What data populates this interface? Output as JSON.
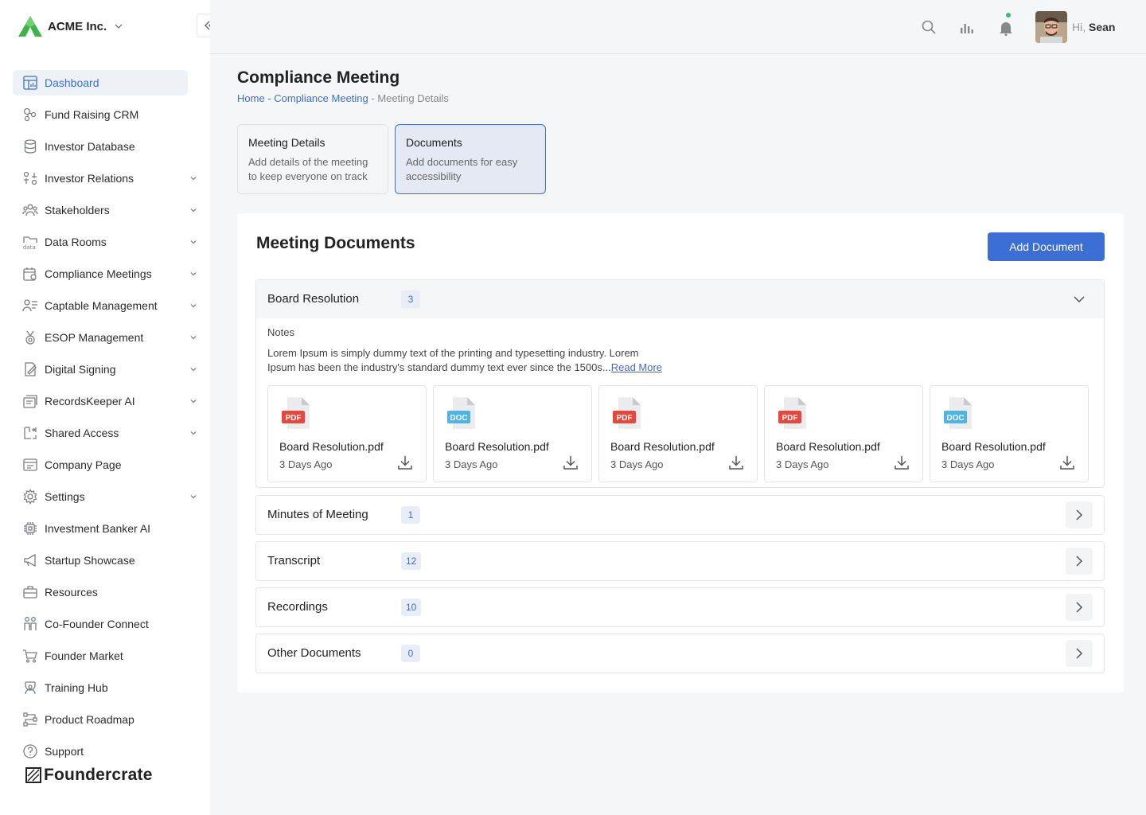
{
  "brand": {
    "name": "ACME Inc."
  },
  "sidebar": {
    "items": [
      {
        "label": "Dashboard",
        "icon": "dashboard-icon",
        "active": true,
        "chevron": false
      },
      {
        "label": "Fund Raising CRM",
        "icon": "crm-icon",
        "chevron": false
      },
      {
        "label": "Investor Database",
        "icon": "database-icon",
        "chevron": false
      },
      {
        "label": "Investor Relations",
        "icon": "relations-icon",
        "chevron": true
      },
      {
        "label": "Stakeholders",
        "icon": "stakeholders-icon",
        "chevron": true
      },
      {
        "label": "Data Rooms",
        "icon": "data-rooms-icon",
        "chevron": true
      },
      {
        "label": "Compliance Meetings",
        "icon": "calendar-gear-icon",
        "chevron": true
      },
      {
        "label": "Captable Management",
        "icon": "captable-icon",
        "chevron": true
      },
      {
        "label": "ESOP Management",
        "icon": "medal-icon",
        "chevron": true
      },
      {
        "label": "Digital Signing",
        "icon": "signing-icon",
        "chevron": true
      },
      {
        "label": "RecordsKeeper AI",
        "icon": "records-icon",
        "chevron": true
      },
      {
        "label": "Shared Access",
        "icon": "shared-access-icon",
        "chevron": true
      },
      {
        "label": "Company Page",
        "icon": "company-page-icon",
        "chevron": false
      },
      {
        "label": "Settings",
        "icon": "gear-icon",
        "chevron": true
      },
      {
        "label": "Investment Banker AI",
        "icon": "chip-icon",
        "chevron": false
      },
      {
        "label": "Startup Showcase",
        "icon": "megaphone-icon",
        "chevron": false
      },
      {
        "label": "Resources",
        "icon": "briefcase-icon",
        "chevron": false
      },
      {
        "label": "Co-Founder Connect",
        "icon": "cofounder-icon",
        "chevron": false
      },
      {
        "label": "Founder Market",
        "icon": "cart-icon",
        "chevron": false
      },
      {
        "label": "Training Hub",
        "icon": "training-icon",
        "chevron": false
      },
      {
        "label": "Product Roadmap",
        "icon": "roadmap-icon",
        "chevron": false
      },
      {
        "label": "Support",
        "icon": "help-icon",
        "chevron": false
      }
    ],
    "footer_logo": "Foundercrate"
  },
  "header": {
    "greeting": "Hi,",
    "user_name": "Sean"
  },
  "page": {
    "title": "Compliance Meeting",
    "breadcrumb": {
      "home": "Home",
      "sep1": " - ",
      "section": "Compliance Meeting",
      "sep2": " - ",
      "current": "Meeting Details"
    }
  },
  "steps": [
    {
      "title": "Meeting Details",
      "desc": "Add details of the meeting to keep everyone on track",
      "active": false
    },
    {
      "title": "Documents",
      "desc": "Add documents for easy accessibility",
      "active": true
    }
  ],
  "documents": {
    "title": "Meeting Documents",
    "add_label": "Add Document",
    "notes_label": "Notes",
    "notes_text": "Lorem Ipsum is simply dummy text of the printing and typesetting industry. Lorem Ipsum has been the industry's standard dummy text ever since the 1500s...",
    "read_more": "Read More",
    "sections": [
      {
        "title": "Board Resolution",
        "count": "3",
        "expanded": true
      },
      {
        "title": "Minutes of Meeting",
        "count": "1",
        "expanded": false
      },
      {
        "title": "Transcript",
        "count": "12",
        "expanded": false
      },
      {
        "title": "Recordings",
        "count": "10",
        "expanded": false
      },
      {
        "title": "Other Documents",
        "count": "0",
        "expanded": false
      }
    ],
    "files": [
      {
        "type": "PDF",
        "name": "Board Resolution.pdf",
        "date": "3 Days Ago"
      },
      {
        "type": "DOC",
        "name": "Board Resolution.pdf",
        "date": "3 Days Ago"
      },
      {
        "type": "PDF",
        "name": "Board Resolution.pdf",
        "date": "3 Days Ago"
      },
      {
        "type": "PDF",
        "name": "Board Resolution.pdf",
        "date": "3 Days Ago"
      },
      {
        "type": "DOC",
        "name": "Board Resolution.pdf",
        "date": "3 Days Ago"
      }
    ]
  },
  "colors": {
    "accent": "#3b6fd6",
    "pdf": "#e8473b",
    "doc": "#4fb3e3",
    "notification": "#36c26b"
  }
}
